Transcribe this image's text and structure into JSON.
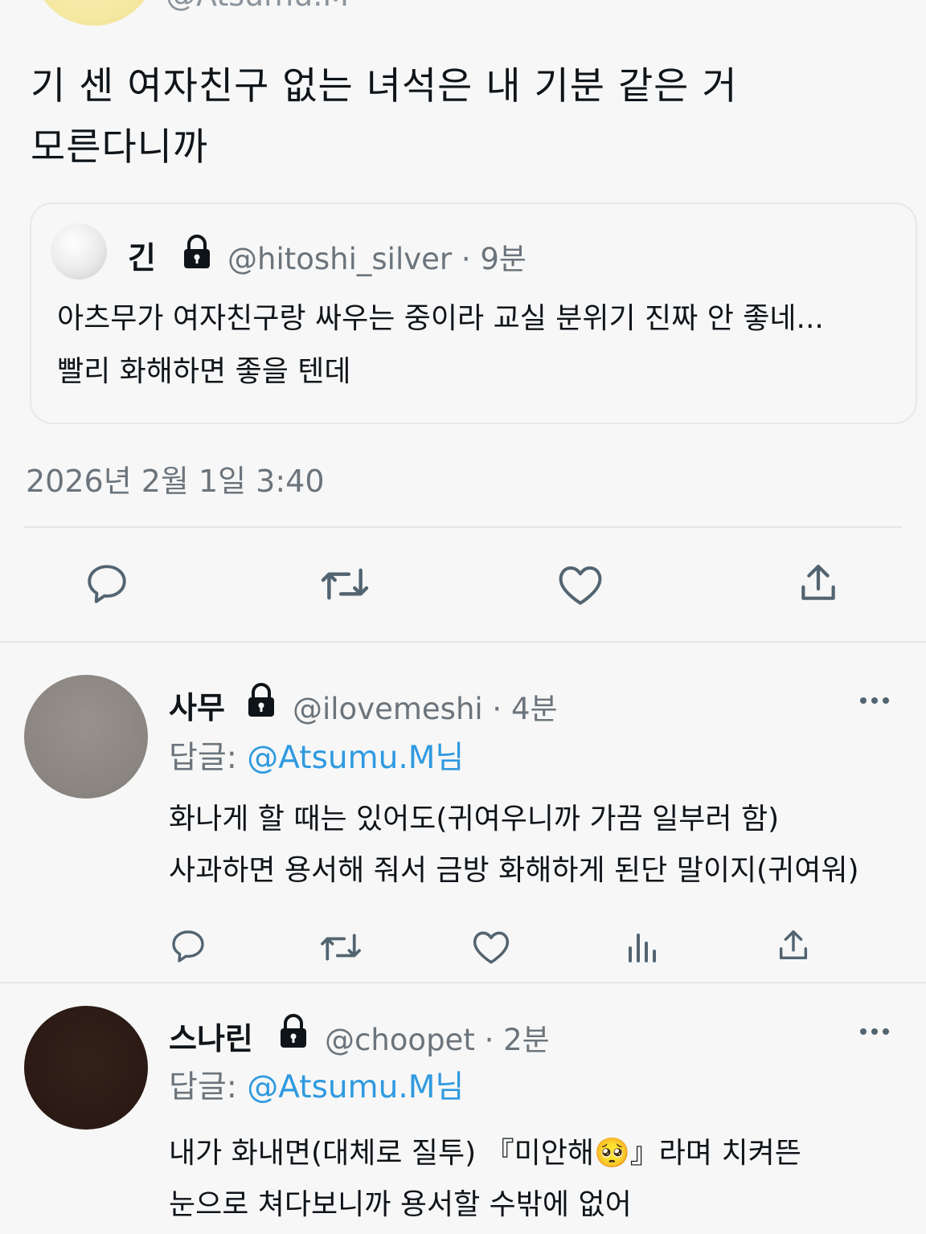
{
  "header": {
    "handle": "@Atsumu.M"
  },
  "tweet": {
    "text_line1": "기 센 여자친구 없는 녀석은 내 기분 같은 거",
    "text_line2": "모른다니까",
    "timestamp": "2026년 2월 1일 3:40"
  },
  "quote": {
    "name": "긴",
    "handle_time": "@hitoshi_silver · 9분",
    "text_line1": "아츠무가 여자친구랑 싸우는 중이라 교실 분위기 진짜 안 좋네...",
    "text_line2": "빨리 화해하면 좋을 텐데"
  },
  "actions": {
    "icons": [
      "reply-icon",
      "retweet-icon",
      "like-icon",
      "share-icon"
    ]
  },
  "replies": [
    {
      "name": "사무",
      "handle_time": "@ilovemeshi · 4분",
      "reply_prefix": "답글: ",
      "reply_mention": "@Atsumu.M님",
      "text_line1": "화나게 할 때는 있어도(귀여우니까 가끔 일부러 함)",
      "text_line2": "사과하면 용서해 줘서 금방 화해하게 된단 말이지(귀여워)",
      "avatar_color": "#8e8a86"
    },
    {
      "name": "스나린",
      "handle_time": "@choopet · 2분",
      "reply_prefix": "답글: ",
      "reply_mention": "@Atsumu.M님",
      "text_line1": "내가 화내면(대체로 질투) 『미안해🥺』라며 치켜뜬",
      "text_line2": "눈으로 쳐다보니까 용서할 수밖에 없어",
      "avatar_color": "#2b1a14"
    }
  ],
  "colors": {
    "background": "#f7f7f7",
    "text": "#0f1419",
    "secondary": "#6b747c",
    "mention": "#2f9ae0",
    "divider": "#e3e5e7"
  }
}
